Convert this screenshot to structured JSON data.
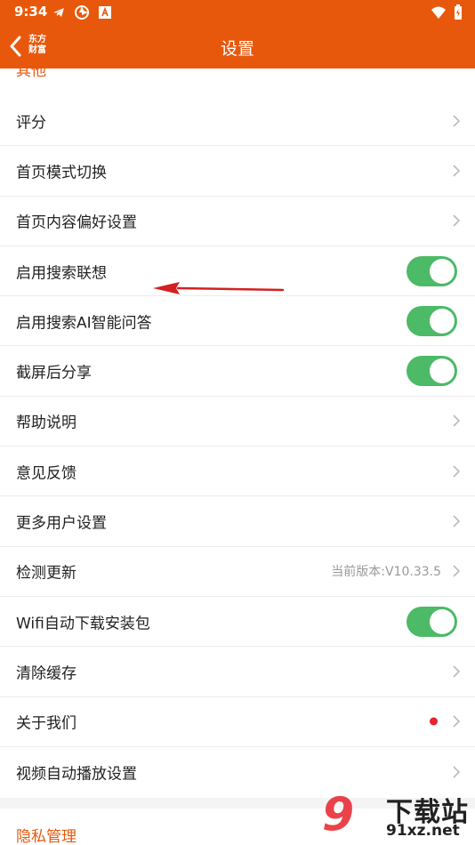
{
  "status_bar": {
    "time": "9:34"
  },
  "header": {
    "title": "设置",
    "logo_line1": "东方",
    "logo_line2": "财富"
  },
  "section_partial": "其他",
  "rows": [
    {
      "label": "评分",
      "type": "link"
    },
    {
      "label": "首页模式切换",
      "type": "link"
    },
    {
      "label": "首页内容偏好设置",
      "type": "link"
    },
    {
      "label": "启用搜索联想",
      "type": "toggle",
      "on": true
    },
    {
      "label": "启用搜索AI智能问答",
      "type": "toggle",
      "on": true
    },
    {
      "label": "截屏后分享",
      "type": "toggle",
      "on": true
    },
    {
      "label": "帮助说明",
      "type": "link"
    },
    {
      "label": "意见反馈",
      "type": "link"
    },
    {
      "label": "更多用户设置",
      "type": "link"
    },
    {
      "label": "检测更新",
      "type": "link",
      "extra": "当前版本:V10.33.5"
    },
    {
      "label": "Wifi自动下载安装包",
      "type": "toggle",
      "on": true
    },
    {
      "label": "清除缓存",
      "type": "link"
    },
    {
      "label": "关于我们",
      "type": "link",
      "badge": "red-dot"
    },
    {
      "label": "视频自动播放设置",
      "type": "link"
    }
  ],
  "privacy_section": "隐私管理",
  "watermark": {
    "num": "9",
    "cn": "下载站",
    "url": "91xz.net"
  },
  "colors": {
    "brand": "#e8580c",
    "toggle_on": "#4cba66",
    "dot": "#e8232b",
    "arrow": "#d42020"
  }
}
